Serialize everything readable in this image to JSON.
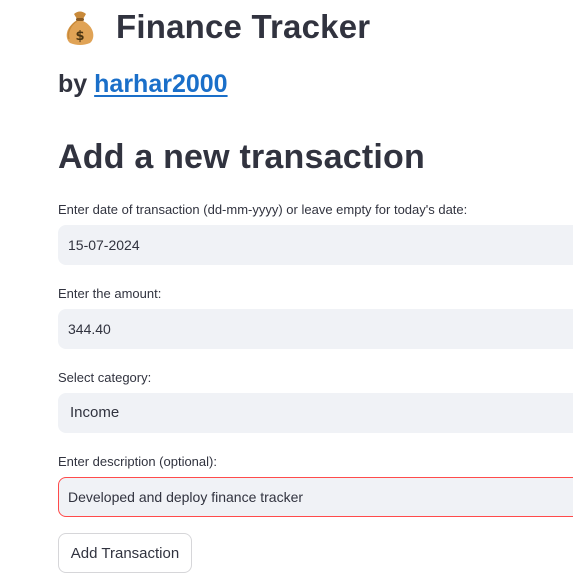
{
  "header": {
    "icon": "money-bag-icon",
    "title": "Finance Tracker"
  },
  "byline": {
    "prefix": "by",
    "author": "harhar2000"
  },
  "form": {
    "heading": "Add a new transaction",
    "date": {
      "label": "Enter date of transaction (dd-mm-yyyy) or leave empty for today's date:",
      "value": "15-07-2024"
    },
    "amount": {
      "label": "Enter the amount:",
      "value": "344.40"
    },
    "category": {
      "label": "Select category:",
      "selected": "Income"
    },
    "description": {
      "label": "Enter description (optional):",
      "value": "Developed and deploy finance tracker"
    },
    "submit_label": "Add Transaction"
  },
  "colors": {
    "link": "#1a6fc9",
    "input_background": "#f0f2f6",
    "focus_border": "#ff4b4b",
    "text": "#31333f"
  }
}
